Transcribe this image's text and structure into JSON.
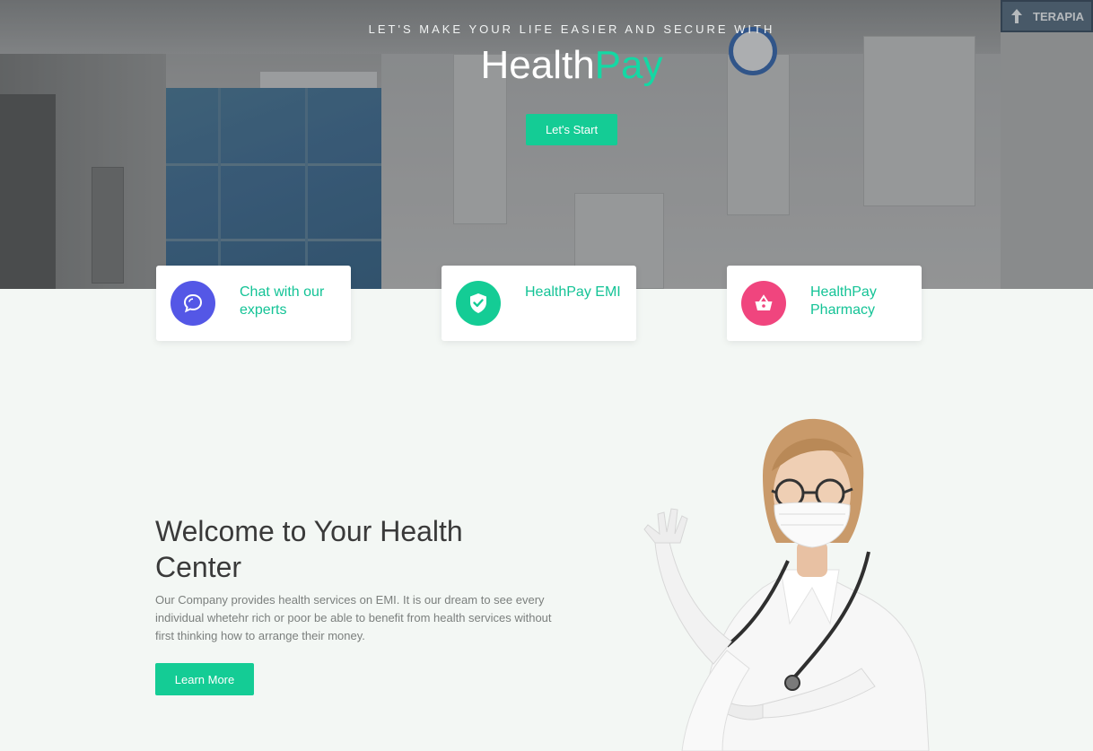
{
  "hero": {
    "tagline": "LET'S MAKE YOUR LIFE EASIER AND SECURE WITH",
    "brand_part1": "Health",
    "brand_part2": "Pay",
    "start_label": "Let's Start",
    "sign_text": "TERAPIA",
    "colors": {
      "accent": "#14cc95",
      "brand_green": "#14d8a4"
    }
  },
  "features": [
    {
      "label": "Chat with our experts",
      "icon": "chat-icon",
      "color": "#5457e6"
    },
    {
      "label": "HealthPay EMI",
      "icon": "shield-check-icon",
      "color": "#14cc95"
    },
    {
      "label": "HealthPay Pharmacy",
      "icon": "basket-icon",
      "color": "#f0457e"
    }
  ],
  "welcome": {
    "title": "Welcome to Your Health Center",
    "text": "Our Company provides health services on EMI. It is our dream to see every individual whetehr rich or poor be able to benefit from health services without first thinking how to arrange their money.",
    "button_label": "Learn More"
  }
}
